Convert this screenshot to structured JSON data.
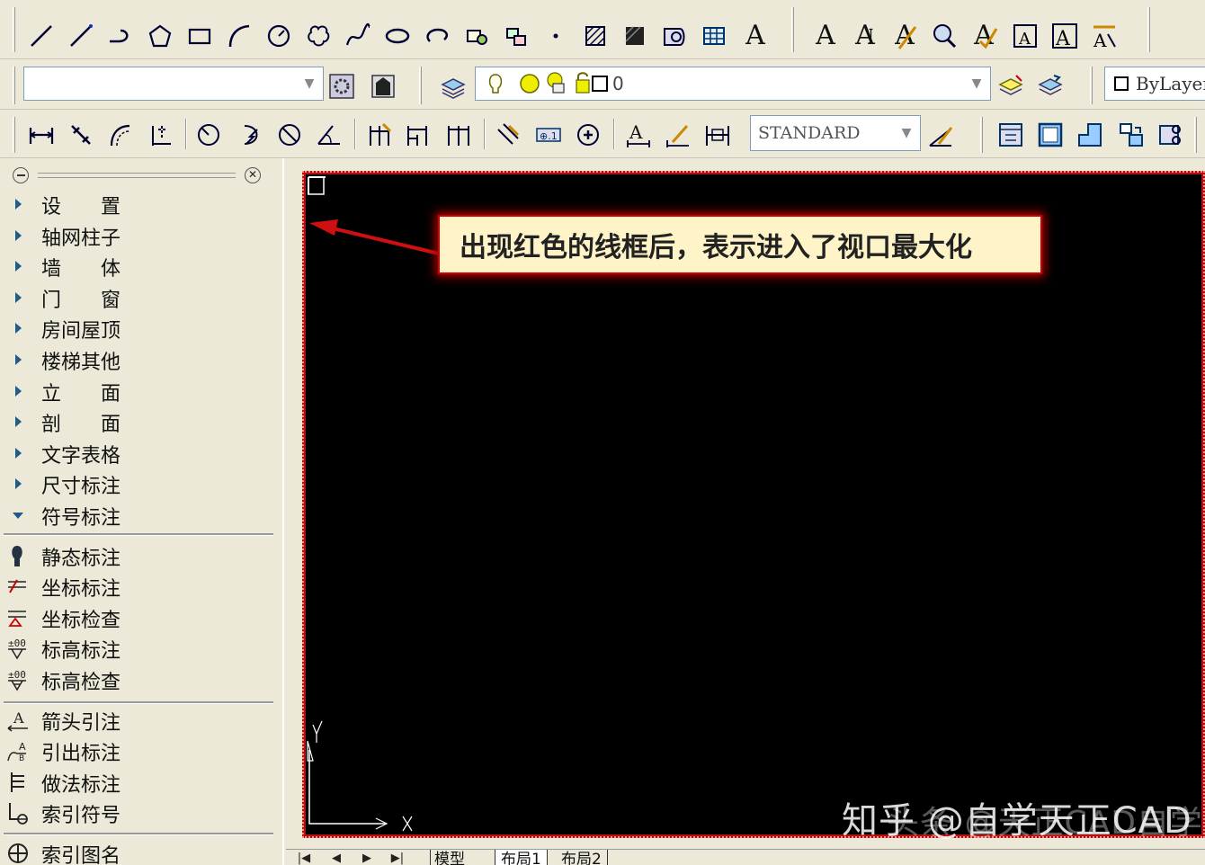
{
  "toolbar_row2": {
    "layer_value": "0",
    "linetype_value": "ByLayer"
  },
  "toolbar_row3": {
    "textstyle_value": "STANDARD"
  },
  "panel": {
    "items": [
      {
        "label": "设　　置",
        "state": "collapsed"
      },
      {
        "label": "轴网柱子",
        "state": "collapsed"
      },
      {
        "label": "墙　　体",
        "state": "collapsed"
      },
      {
        "label": "门　　窗",
        "state": "collapsed"
      },
      {
        "label": "房间屋顶",
        "state": "collapsed"
      },
      {
        "label": "楼梯其他",
        "state": "collapsed"
      },
      {
        "label": "立　　面",
        "state": "collapsed"
      },
      {
        "label": "剖　　面",
        "state": "collapsed"
      },
      {
        "label": "文字表格",
        "state": "collapsed"
      },
      {
        "label": "尺寸标注",
        "state": "collapsed"
      },
      {
        "label": "符号标注",
        "state": "expanded"
      }
    ],
    "subitems": [
      {
        "label": "静态标注",
        "icon": "bulb-icon"
      },
      {
        "label": "坐标标注",
        "icon": "coordinate-dim-icon"
      },
      {
        "label": "坐标检查",
        "icon": "coordinate-check-icon"
      },
      {
        "label": "标高标注",
        "icon": "elevation-dim-icon"
      },
      {
        "label": "标高检查",
        "icon": "elevation-check-icon"
      },
      {
        "label": "箭头引注",
        "icon": "arrow-leader-icon"
      },
      {
        "label": "引出标注",
        "icon": "leader-dim-icon"
      },
      {
        "label": "做法标注",
        "icon": "method-dim-icon"
      },
      {
        "label": "索引符号",
        "icon": "index-symbol-icon"
      },
      {
        "label": "索引图名",
        "icon": "index-title-icon"
      }
    ]
  },
  "callout": {
    "text": "出现红色的线框后，表示进入了视口最大化"
  },
  "tabs": [
    "模型",
    "布局1",
    "布局2"
  ],
  "watermark": "知乎 @自学天正CAD",
  "watermark_ghost": "头条 @天正CAD自学",
  "colors": {
    "viewport_border": "#b01010",
    "viewport_bg": "#000000",
    "callout_bg": "#fff4c8",
    "chrome": "#ece9d8"
  }
}
